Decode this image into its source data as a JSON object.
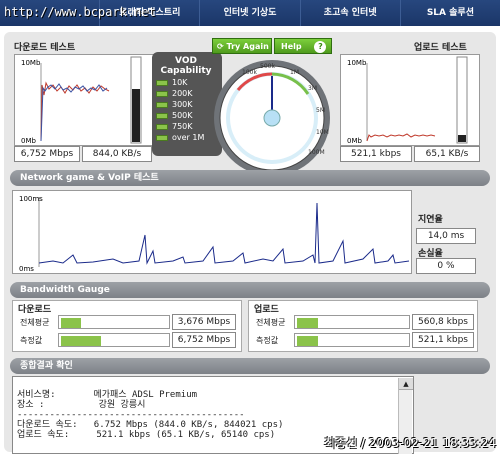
{
  "watermark": "http://www.bcpark.net",
  "topnav": {
    "items": [
      "",
      "트래픽 디스트리",
      "인터넷 기상도",
      "초고속 인터넷",
      "SLA 솔루션"
    ]
  },
  "download": {
    "title": "다운로드 테스트",
    "axis_top": "10Mb",
    "axis_bottom": "0Mb",
    "speed_mbps": "6,752 Mbps",
    "speed_kbs": "844,0 KB/s"
  },
  "upload": {
    "title": "업로드 테스트",
    "axis_top": "10Mb",
    "axis_bottom": "0Mb",
    "speed_kbps": "521,1 kbps",
    "speed_kbs": "65,1 KB/s"
  },
  "vod": {
    "title": "VOD Capability",
    "levels": [
      "10K",
      "200K",
      "300K",
      "500K",
      "750K",
      "over 1M"
    ]
  },
  "gauge": {
    "try_again": "Try Again",
    "help": "Help",
    "help_icon": "?",
    "ticks": [
      "100k",
      "500k",
      "1M",
      "3M",
      "5M",
      "10M",
      "100M"
    ]
  },
  "network": {
    "title": "Network game & VoIP 테스트",
    "axis_top": "100ms",
    "axis_bottom": "0ms",
    "latency_label": "지연율",
    "latency_value": "14,0 ms",
    "loss_label": "손실율",
    "loss_value": "0 %"
  },
  "bandwidth": {
    "title": "Bandwidth Gauge",
    "down_title": "다운로드",
    "up_title": "업로드",
    "avg_label": "전체평균",
    "measured_label": "측정값",
    "down_avg": "3,676 Mbps",
    "down_measured": "6,752 Mbps",
    "up_avg": "560,8 kbps",
    "up_measured": "521,1 kbps",
    "down_avg_fraction": 0.22,
    "down_measured_fraction": 0.4,
    "up_avg_fraction": 0.22,
    "up_measured_fraction": 0.22
  },
  "summary": {
    "title": "종합결과 확인",
    "lines": [
      "서비스명:       메가패스 ADSL Premium",
      "장소 :          강원 강릉시",
      "------------------------------------------",
      "",
      "다운로드 속도:   6.752 Mbps (844.0 KB/s, 844021 cps)",
      "업로드 속도:     521.1 kbps (65.1 KB/s, 65140 cps)"
    ]
  },
  "signature": "최종선 / 2003-02-21 18:33:24",
  "colors": {
    "nav": "#1b3668",
    "accent_green": "#8bc34a",
    "download_line": "#c0392b",
    "upload_line": "#c0392b",
    "network_line": "#1a2a8a"
  }
}
